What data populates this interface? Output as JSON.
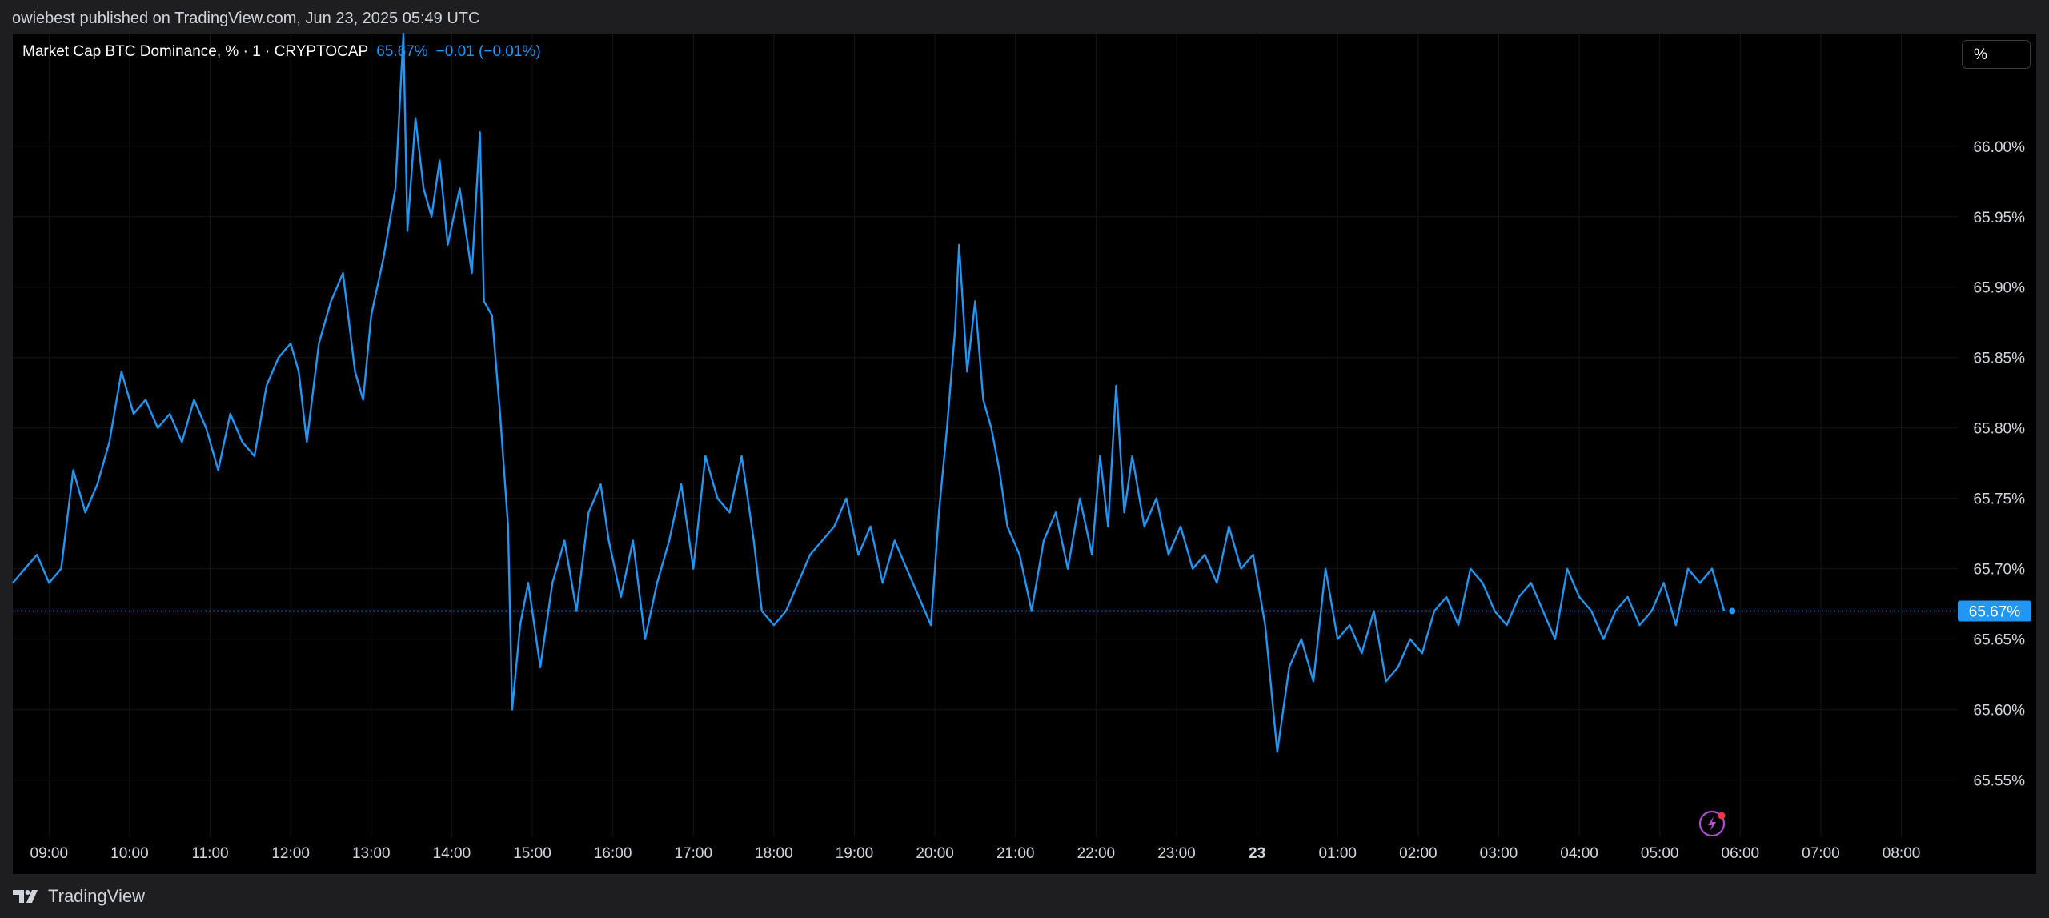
{
  "header": {
    "publish_line": "owiebest published on TradingView.com, Jun 23, 2025 05:49 UTC"
  },
  "legend": {
    "symbol": "Market Cap BTC Dominance, % · 1 · CRYPTOCAP",
    "last_value": "65.67%",
    "change": "−0.01 (−0.01%)"
  },
  "price_scale": {
    "unit_button": "%"
  },
  "footer": {
    "brand": "TradingView"
  },
  "colors": {
    "series": "#2196f3",
    "background": "#000000",
    "frame": "#1e1e20",
    "grid": "#151518",
    "text": "#d1d4dc",
    "last_price_badge": "#2196f3"
  },
  "icons": {
    "realtime": "lightning-bolt-icon",
    "logo": "tradingview-logo-icon"
  },
  "chart_data": {
    "type": "line",
    "title": "Market Cap BTC Dominance, % · 1 · CRYPTOCAP",
    "xlabel": "",
    "ylabel": "",
    "grid": true,
    "y_axis_side": "right",
    "ylim": [
      65.51,
      66.08
    ],
    "y_ticks": [
      66.0,
      65.95,
      65.9,
      65.85,
      65.8,
      65.75,
      65.7,
      65.65,
      65.6,
      65.55
    ],
    "y_tick_labels": [
      "66.00%",
      "65.95%",
      "65.90%",
      "65.85%",
      "65.80%",
      "65.75%",
      "65.70%",
      "65.65%",
      "65.60%",
      "65.55%"
    ],
    "x_range_hours": [
      8.55,
      32.7
    ],
    "x_ticks": [
      9,
      10,
      11,
      12,
      13,
      14,
      15,
      16,
      17,
      18,
      19,
      20,
      21,
      22,
      23,
      24,
      25,
      26,
      27,
      28,
      29,
      30,
      31,
      32
    ],
    "x_tick_labels": [
      "09:00",
      "10:00",
      "11:00",
      "12:00",
      "13:00",
      "14:00",
      "15:00",
      "16:00",
      "17:00",
      "18:00",
      "19:00",
      "20:00",
      "21:00",
      "22:00",
      "23:00",
      "23",
      "01:00",
      "02:00",
      "03:00",
      "04:00",
      "05:00",
      "06:00",
      "07:00",
      "08:00"
    ],
    "bold_ticks": [
      "23"
    ],
    "last_value": 65.67,
    "last_value_label": "65.67%",
    "series": [
      {
        "name": "Market Cap BTC Dominance",
        "x_hours": [
          8.55,
          8.7,
          8.85,
          9.0,
          9.15,
          9.3,
          9.45,
          9.6,
          9.75,
          9.9,
          10.05,
          10.2,
          10.35,
          10.5,
          10.65,
          10.8,
          10.95,
          11.1,
          11.25,
          11.4,
          11.55,
          11.7,
          11.85,
          12.0,
          12.1,
          12.2,
          12.35,
          12.5,
          12.65,
          12.8,
          12.9,
          13.0,
          13.15,
          13.3,
          13.4,
          13.45,
          13.55,
          13.65,
          13.75,
          13.85,
          13.95,
          14.1,
          14.25,
          14.35,
          14.4,
          14.5,
          14.6,
          14.7,
          14.75,
          14.85,
          14.95,
          15.1,
          15.25,
          15.4,
          15.55,
          15.7,
          15.85,
          15.95,
          16.1,
          16.25,
          16.4,
          16.55,
          16.7,
          16.85,
          17.0,
          17.15,
          17.3,
          17.45,
          17.6,
          17.75,
          17.85,
          18.0,
          18.15,
          18.3,
          18.45,
          18.6,
          18.75,
          18.9,
          19.05,
          19.2,
          19.35,
          19.5,
          19.65,
          19.8,
          19.95,
          20.05,
          20.15,
          20.25,
          20.3,
          20.4,
          20.5,
          20.6,
          20.7,
          20.8,
          20.9,
          21.05,
          21.2,
          21.35,
          21.5,
          21.65,
          21.8,
          21.95,
          22.05,
          22.15,
          22.25,
          22.35,
          22.45,
          22.6,
          22.75,
          22.9,
          23.05,
          23.2,
          23.35,
          23.5,
          23.65,
          23.8,
          23.95,
          24.1,
          24.25,
          24.4,
          24.55,
          24.7,
          24.85,
          25.0,
          25.15,
          25.3,
          25.45,
          25.6,
          25.75,
          25.9,
          26.05,
          26.2,
          26.35,
          26.5,
          26.65,
          26.8,
          26.95,
          27.1,
          27.25,
          27.4,
          27.55,
          27.7,
          27.85,
          28.0,
          28.15,
          28.3,
          28.45,
          28.6,
          28.75,
          28.9,
          29.05,
          29.2,
          29.35,
          29.5,
          29.65,
          29.8,
          29.9
        ],
        "values": [
          65.69,
          65.7,
          65.71,
          65.69,
          65.7,
          65.77,
          65.74,
          65.76,
          65.79,
          65.84,
          65.81,
          65.82,
          65.8,
          65.81,
          65.79,
          65.82,
          65.8,
          65.77,
          65.81,
          65.79,
          65.78,
          65.83,
          65.85,
          65.86,
          65.84,
          65.79,
          65.86,
          65.89,
          65.91,
          65.84,
          65.82,
          65.88,
          65.92,
          65.97,
          66.08,
          65.94,
          66.02,
          65.97,
          65.95,
          65.99,
          65.93,
          65.97,
          65.91,
          66.01,
          65.89,
          65.88,
          65.81,
          65.73,
          65.6,
          65.66,
          65.69,
          65.63,
          65.69,
          65.72,
          65.67,
          65.74,
          65.76,
          65.72,
          65.68,
          65.72,
          65.65,
          65.69,
          65.72,
          65.76,
          65.7,
          65.78,
          65.75,
          65.74,
          65.78,
          65.72,
          65.67,
          65.66,
          65.67,
          65.69,
          65.71,
          65.72,
          65.73,
          65.75,
          65.71,
          65.73,
          65.69,
          65.72,
          65.7,
          65.68,
          65.66,
          65.74,
          65.8,
          65.87,
          65.93,
          65.84,
          65.89,
          65.82,
          65.8,
          65.77,
          65.73,
          65.71,
          65.67,
          65.72,
          65.74,
          65.7,
          65.75,
          65.71,
          65.78,
          65.73,
          65.83,
          65.74,
          65.78,
          65.73,
          65.75,
          65.71,
          65.73,
          65.7,
          65.71,
          65.69,
          65.73,
          65.7,
          65.71,
          65.66,
          65.57,
          65.63,
          65.65,
          65.62,
          65.7,
          65.65,
          65.66,
          65.64,
          65.67,
          65.62,
          65.63,
          65.65,
          65.64,
          65.67,
          65.68,
          65.66,
          65.7,
          65.69,
          65.67,
          65.66,
          65.68,
          65.69,
          65.67,
          65.65,
          65.7,
          65.68,
          65.67,
          65.65,
          65.67,
          65.68,
          65.66,
          65.67,
          65.69,
          65.66,
          65.7,
          65.69,
          65.7,
          65.67
        ]
      }
    ]
  }
}
